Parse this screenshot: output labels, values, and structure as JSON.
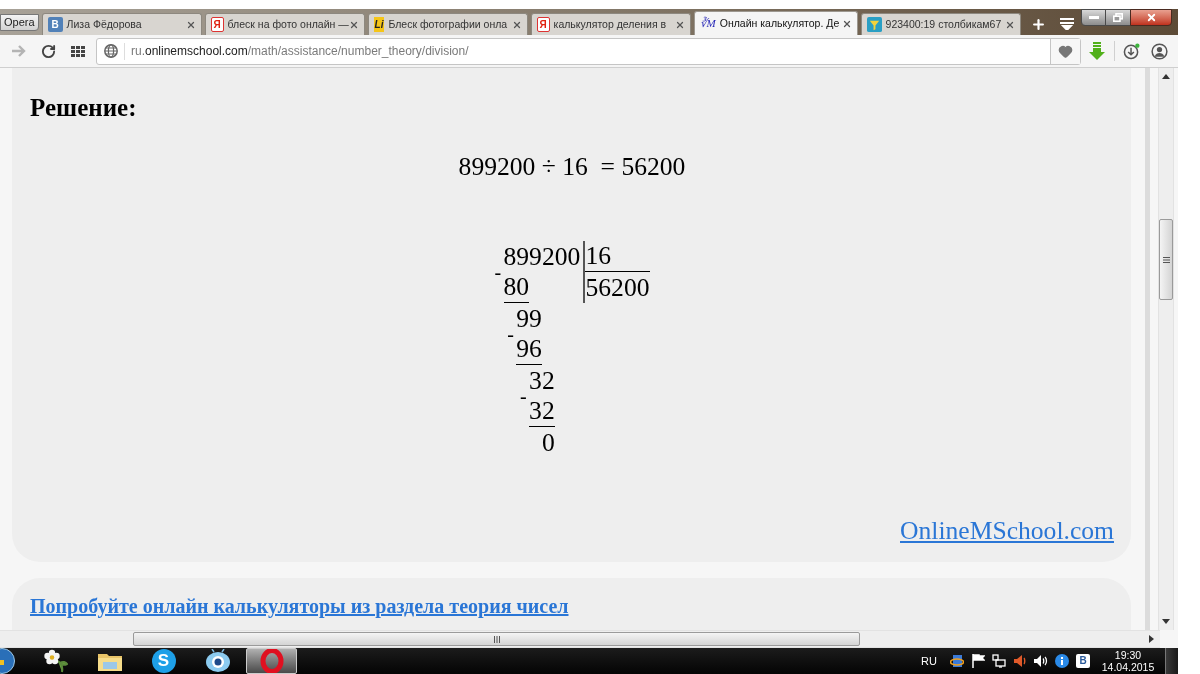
{
  "browser": {
    "menu_button": "Opera",
    "tabs": [
      {
        "kind": "badge",
        "icon_text": "В",
        "title": "Лиза Фёдорова",
        "selected": false
      },
      {
        "kind": "search",
        "icon_text": "Я",
        "title": "блеск на фото онлайн —",
        "selected": false
      },
      {
        "kind": "stylized",
        "icon_text": "Li",
        "title": "Блеск фотографии онла",
        "selected": false
      },
      {
        "kind": "search",
        "icon_text": "Я",
        "title": "калькулятор деления в",
        "selected": false
      },
      {
        "kind": "math",
        "icon_text": "∛M",
        "title": "Онлайн калькулятор. Де",
        "selected": true
      },
      {
        "kind": "picture",
        "title": "923400:19 столбикам67",
        "selected": false
      }
    ],
    "toolbar": {
      "forward": {
        "disabled": true
      },
      "address": {
        "prefix": "ru.",
        "domain": "onlinemschool.com",
        "path": "/math/assistance/number_theory/division/"
      }
    }
  },
  "solution": {
    "heading": "Решение:",
    "equation": "899200 ÷ 16  = 56200",
    "long_division": {
      "dividend": "899200",
      "divisor": "16",
      "quotient": "56200",
      "steps": [
        {
          "kind": "subtrahend",
          "sign": "-",
          "value": "80"
        },
        {
          "kind": "partial",
          "value": "99"
        },
        {
          "kind": "subtrahend",
          "sign": "-",
          "value": "96"
        },
        {
          "kind": "partial",
          "value": "32"
        },
        {
          "kind": "subtrahend",
          "sign": "-",
          "value": "32"
        },
        {
          "kind": "remainder",
          "value": "0"
        }
      ]
    },
    "site_link": "OnlineMSchool.com"
  },
  "related": {
    "link": "Попробуйте онлайн калькуляторы из раздела теория чисел"
  },
  "taskbar": {
    "apps": [
      {
        "kind": "flower",
        "selected": false
      },
      {
        "kind": "folder",
        "selected": false
      },
      {
        "kind": "messenger",
        "label": "S",
        "selected": false
      },
      {
        "kind": "camera",
        "selected": false
      },
      {
        "kind": "browser",
        "selected": true
      }
    ],
    "tray": {
      "language": "RU",
      "badge_letter": "В",
      "time": "19:30",
      "date": "14.04.2015"
    }
  }
}
